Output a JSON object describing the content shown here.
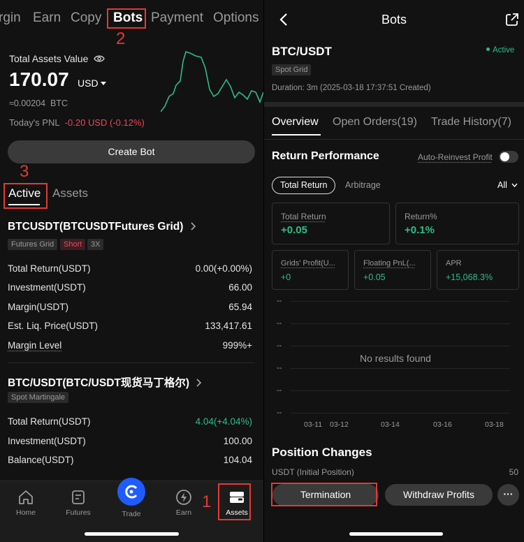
{
  "left": {
    "top_tabs": [
      "rgin",
      "Earn",
      "Copy",
      "Bots",
      "Payment",
      "Options"
    ],
    "callouts": {
      "bots": "2",
      "active": "3",
      "assets": "1"
    },
    "total_assets_label": "Total Assets Value",
    "total_assets_value": "170.07",
    "currency": "USD",
    "btc_value": "≈0.00204",
    "btc_unit": "BTC",
    "pnl_label": "Today's PNL",
    "pnl_value": "-0.20 USD (-0.12%)",
    "create_bot": "Create Bot",
    "list_tabs": {
      "active": "Active",
      "assets": "Assets"
    },
    "bot1": {
      "title": "BTCUSDT(BTCUSDTFutures Grid)",
      "tags": [
        "Futures Grid",
        "Short",
        "3X"
      ],
      "rows": [
        {
          "label": "Total Return(USDT)",
          "value": "0.00(+0.00%)"
        },
        {
          "label": "Investment(USDT)",
          "value": "66.00"
        },
        {
          "label": "Margin(USDT)",
          "value": "65.94"
        },
        {
          "label": "Est. Liq. Price(USDT)",
          "value": "133,417.61"
        },
        {
          "label": "Margin Level",
          "value": "999%+"
        }
      ]
    },
    "bot2": {
      "title": "BTC/USDT(BTC/USDT现货马丁格尔)",
      "tags": [
        "Spot Martingale"
      ],
      "rows": [
        {
          "label": "Total Return(USDT)",
          "value": "4.04(+4.04%)"
        },
        {
          "label": "Investment(USDT)",
          "value": "100.00"
        },
        {
          "label": "Balance(USDT)",
          "value": "104.04"
        }
      ]
    },
    "nav": [
      "Home",
      "Futures",
      "Trade",
      "Earn",
      "Assets"
    ],
    "colors": {
      "green": "#2ebd85",
      "red": "#f0445a",
      "accent": "#1f5cff"
    }
  },
  "right": {
    "header_title": "Bots",
    "pair": "BTC/USDT",
    "status": "Active",
    "type_tag": "Spot Grid",
    "duration": "Duration: 3m (2025-03-18 17:37:51 Created)",
    "tabs": [
      "Overview",
      "Open Orders(19)",
      "Trade History(7)"
    ],
    "return_performance": "Return Performance",
    "auto_reinvest": "Auto-Reinvest Profit",
    "filter_pills": [
      "Total Return",
      "Arbitrage"
    ],
    "range": "All",
    "cards": [
      {
        "label": "Total Return",
        "value": "+0.05"
      },
      {
        "label": "Return%",
        "value": "+0.1%"
      },
      {
        "label": "Grids' Profit(U...",
        "value": "+0"
      },
      {
        "label": "Floating PnL(...",
        "value": "+0.05"
      },
      {
        "label": "APR",
        "value": "+15,068.3%"
      }
    ],
    "chart_placeholder": "--",
    "no_results": "No results found",
    "x_ticks": [
      "03-11",
      "03-12",
      "03-14",
      "03-16",
      "03-18"
    ],
    "position_changes": "Position Changes",
    "partial_row_label": "USDT (Initial Position)",
    "partial_row_value": "50",
    "termination": "Termination",
    "withdraw": "Withdraw Profits",
    "more": "···"
  }
}
